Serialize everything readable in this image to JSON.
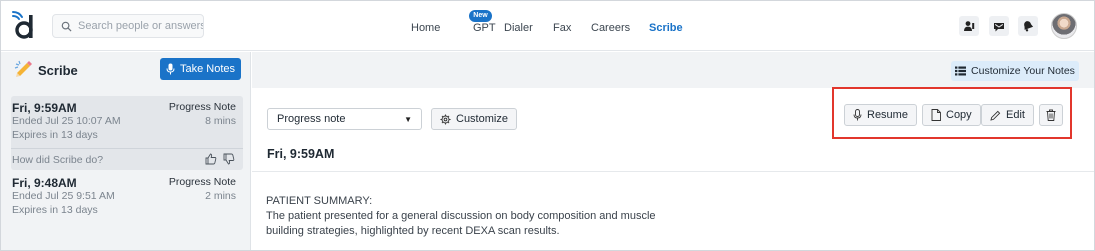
{
  "topnav": {
    "search_placeholder": "Search people or answers",
    "links": [
      "Home",
      "GPT",
      "Dialer",
      "Fax",
      "Careers",
      "Scribe"
    ],
    "active": "Scribe",
    "new_badge": "New",
    "icons": [
      "contacts-icon",
      "messages-icon",
      "notifications-icon"
    ]
  },
  "sidebar": {
    "title": "Scribe",
    "take_notes_label": "Take Notes",
    "notes": [
      {
        "time": "Fri, 9:59AM",
        "type": "Progress Note",
        "ended": "Ended Jul 25 10:07 AM",
        "duration": "8 mins",
        "expires": "Expires in 13 days",
        "feedback_question": "How did Scribe do?"
      },
      {
        "time": "Fri, 9:48AM",
        "type": "Progress Note",
        "ended": "Ended Jul 25 9:51 AM",
        "duration": "2 mins",
        "expires": "Expires in 13 days"
      }
    ]
  },
  "main": {
    "customize_notes_label": "Customize Your Notes",
    "note_type_selected": "Progress note",
    "customize_label": "Customize",
    "actions": {
      "resume": "Resume",
      "copy": "Copy",
      "edit": "Edit"
    },
    "note_heading": "Fri, 9:59AM",
    "body_section": "PATIENT SUMMARY:",
    "body_line1": "The patient presented for a general discussion on body composition and muscle",
    "body_line2": "building strategies, highlighted by recent DEXA scan results."
  },
  "colors": {
    "accent": "#1a73c8",
    "highlight_box": "#e2362c"
  }
}
